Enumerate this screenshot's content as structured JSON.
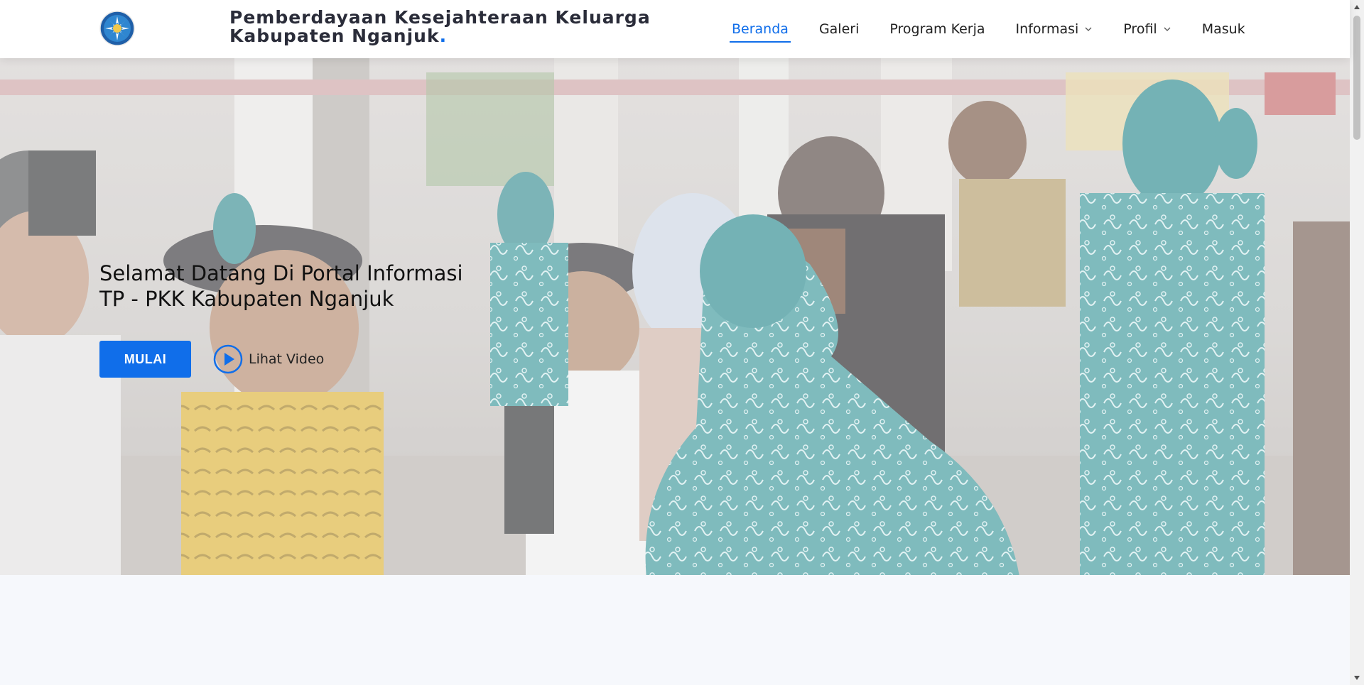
{
  "header": {
    "title_line1": "Pemberdayaan Kesejahteraan Keluarga",
    "title_line2": "Kabupaten Nganjuk",
    "title_dot": ".",
    "logo_icon": "pkk-emblem-icon"
  },
  "nav": {
    "items": [
      {
        "label": "Beranda",
        "active": true
      },
      {
        "label": "Galeri"
      },
      {
        "label": "Program Kerja"
      },
      {
        "label": "Informasi",
        "dropdown": true
      },
      {
        "label": "Profil",
        "dropdown": true
      },
      {
        "label": "Masuk"
      }
    ]
  },
  "hero": {
    "headline_line1": "Selamat Datang Di Portal Informasi",
    "headline_line2": "TP - PKK Kabupaten Nganjuk",
    "primary_button": "MULAI",
    "video_link": "Lihat Video"
  },
  "colors": {
    "accent": "#106eea",
    "title_text": "#2a2c39",
    "batik_teal": "#3f9a9c"
  }
}
